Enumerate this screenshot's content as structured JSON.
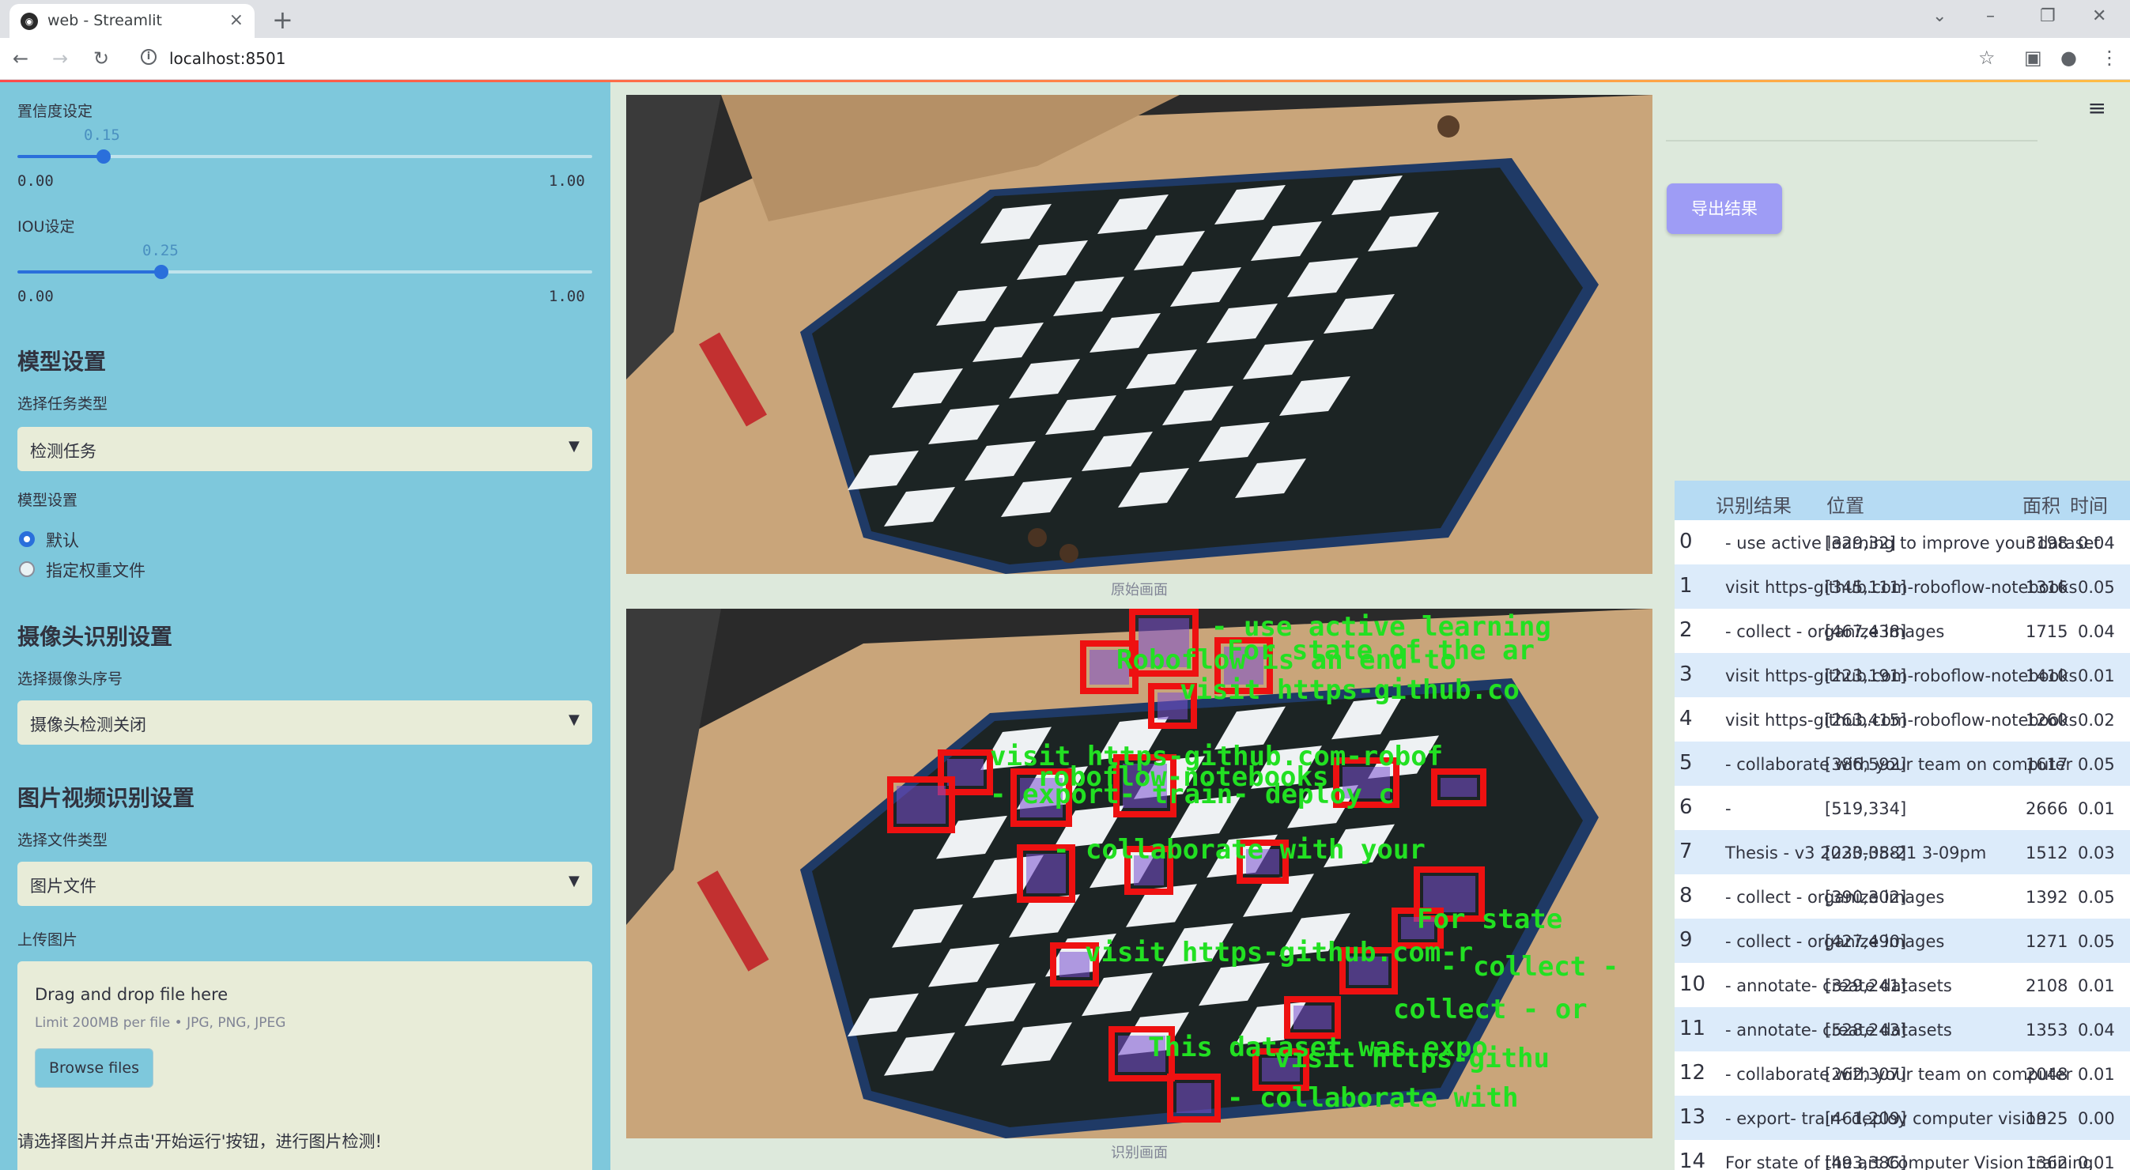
{
  "browser": {
    "tab_title": "web - Streamlit",
    "url": "localhost:8501"
  },
  "sidebar": {
    "confidence": {
      "label": "置信度设定",
      "value": "0.15",
      "min": "0.00",
      "max": "1.00",
      "fraction": 0.15
    },
    "iou": {
      "label": "IOU设定",
      "value": "0.25",
      "min": "0.00",
      "max": "1.00",
      "fraction": 0.25
    },
    "model_section": "模型设置",
    "task_type_label": "选择任务类型",
    "task_type_value": "检测任务",
    "model_label": "模型设置",
    "radio_default": "默认",
    "radio_custom": "指定权重文件",
    "camera_section": "摄像头识别设置",
    "camera_label": "选择摄像头序号",
    "camera_value": "摄像头检测关闭",
    "media_section": "图片视频识别设置",
    "file_type_label": "选择文件类型",
    "file_type_value": "图片文件",
    "upload_label": "上传图片",
    "upload_drag": "Drag and drop file here",
    "upload_limit": "Limit 200MB per file • JPG, PNG, JPEG",
    "upload_button": "Browse files",
    "hint": "请选择图片并点击'开始运行'按钮，进行图片检测!"
  },
  "main": {
    "original_caption": "原始画面",
    "detected_caption": "识别画面",
    "export_button": "导出结果",
    "overlay_texts": [
      "- use active learning",
      "For state of the ar",
      "Roboflow is an end-to",
      "visit https-github.co",
      "visit https-github.com-robof",
      "roboflow-notebooks",
      "- export- train- deploy c",
      "- collaborate with your",
      "visit https-github.com-r",
      "For state",
      "- collect -",
      "collect - or",
      "This dataset was expo",
      "visit https-githu",
      "- collaborate with"
    ],
    "table": {
      "headers": [
        "",
        "识别结果",
        "位置",
        "面积",
        "时间"
      ],
      "rows": [
        {
          "idx": "0",
          "result": "- use active learning to improve your dataset",
          "pos": "[329,32]",
          "area": "3198",
          "time": "0.04"
        },
        {
          "idx": "1",
          "result": "visit https-github.com-roboflow-notebooks",
          "pos": "[345,111]",
          "area": "1316",
          "time": "0.05"
        },
        {
          "idx": "2",
          "result": "- collect - organize images",
          "pos": "[467,438]",
          "area": "1715",
          "time": "0.04"
        },
        {
          "idx": "3",
          "result": "visit https-github.com-roboflow-notebooks",
          "pos": "[223,191]",
          "area": "1410",
          "time": "0.01"
        },
        {
          "idx": "4",
          "result": "visit https-github.com-roboflow-notebooks",
          "pos": "[263,415]",
          "area": "1260",
          "time": "0.02"
        },
        {
          "idx": "5",
          "result": "- collaborate with your team on computer",
          "pos": "[386,592]",
          "area": "1617",
          "time": "0.05"
        },
        {
          "idx": "6",
          "result": "-",
          "pos": "[519,334]",
          "area": "2666",
          "time": "0.01"
        },
        {
          "idx": "7",
          "result": "Thesis - v3 2023-08-21 3-09pm",
          "pos": "[230,358]",
          "area": "1512",
          "time": "0.03"
        },
        {
          "idx": "8",
          "result": "- collect - organize images",
          "pos": "[390,302]",
          "area": "1392",
          "time": "0.05"
        },
        {
          "idx": "9",
          "result": "- collect - organize images",
          "pos": "[427,490]",
          "area": "1271",
          "time": "0.05"
        },
        {
          "idx": "10",
          "result": "- annotate- create datasets",
          "pos": "[329,241]",
          "area": "2108",
          "time": "0.01"
        },
        {
          "idx": "11",
          "result": "- annotate- create datasets",
          "pos": "[528,243]",
          "area": "1353",
          "time": "0.04"
        },
        {
          "idx": "12",
          "result": "- collaborate with your team on computer",
          "pos": "[262,307]",
          "area": "2048",
          "time": "0.01"
        },
        {
          "idx": "13",
          "result": "- export- train- deploy computer vision",
          "pos": "[461,209]",
          "area": "1925",
          "time": "0.00"
        },
        {
          "idx": "14",
          "result": "For state of the art Computer Vision training",
          "pos": "[493,386]",
          "area": "1362",
          "time": "0.01"
        }
      ]
    }
  }
}
